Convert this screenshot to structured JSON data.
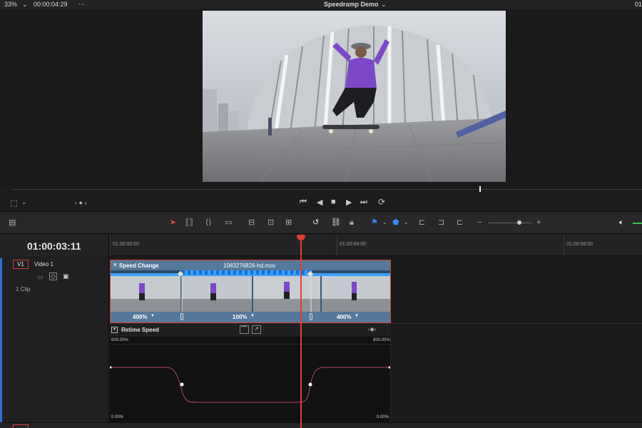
{
  "topbar": {
    "zoom": "33%",
    "timecode": "00:00:04:29",
    "project_title": "Speedramp Demo",
    "right_partial": "01"
  },
  "timeline": {
    "current_timecode": "01:00:03:11",
    "ruler_labels": [
      "01:00:00:00",
      "01:00:04:00",
      "01:00:08:00"
    ]
  },
  "track": {
    "id": "V1",
    "name": "Video 1",
    "clip_count": "1 Clip"
  },
  "clip": {
    "effect_label": "Speed Change",
    "filename": "1083276826-hd.mov",
    "segments": [
      {
        "speed": "400%"
      },
      {
        "speed": "100%"
      },
      {
        "speed": "400%"
      }
    ]
  },
  "retime_curve": {
    "title": "Retime Speed",
    "top_left_label": "600.00%",
    "top_right_label": "600.00%",
    "bottom_left_label": "0.00%",
    "bottom_right_label": "0.00%"
  },
  "colors": {
    "accent_blue": "#3aa0ff",
    "playhead_red": "#e43c32",
    "clip_border": "#d0413b",
    "clip_body": "#5a7f9f"
  },
  "icons": {
    "viewer_options": "frame-icon",
    "transport": [
      "skip-start-icon",
      "step-back-icon",
      "stop-icon",
      "play-icon",
      "skip-end-icon",
      "loop-icon"
    ],
    "edit_tools": [
      "pointer-icon",
      "trim-icon",
      "dynamic-trim-icon",
      "blade-icon"
    ],
    "snapping": [
      "snap-icon",
      "link-icon",
      "lock-icon"
    ],
    "audio": "speaker-icon"
  }
}
